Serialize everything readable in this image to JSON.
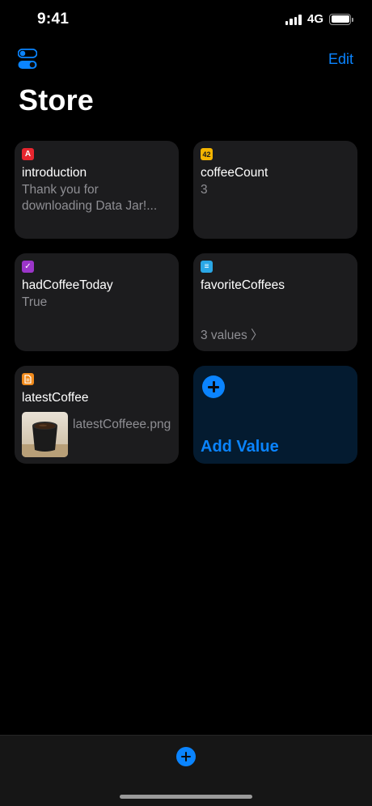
{
  "status": {
    "time": "9:41",
    "network": "4G"
  },
  "nav": {
    "edit_label": "Edit",
    "title": "Store"
  },
  "cards": [
    {
      "badge": "A",
      "badge_icon": "text-type-icon",
      "key": "introduction",
      "value": "Thank you for downloading Data Jar!..."
    },
    {
      "badge": "42",
      "badge_icon": "number-type-icon",
      "key": "coffeeCount",
      "value": "3"
    },
    {
      "badge": "✓",
      "badge_icon": "boolean-type-icon",
      "key": "hadCoffeeToday",
      "value": "True"
    },
    {
      "badge": "≡",
      "badge_icon": "list-type-icon",
      "key": "favoriteCoffees",
      "value": "3 values 〉"
    },
    {
      "badge": "",
      "badge_icon": "file-type-icon",
      "key": "latestCoffee",
      "value": "latestCoffeee.png"
    }
  ],
  "add_card": {
    "label": "Add Value"
  },
  "colors": {
    "accent": "#0a84ff",
    "card": "#1c1c1e",
    "secondary_text": "#8e8e93"
  }
}
